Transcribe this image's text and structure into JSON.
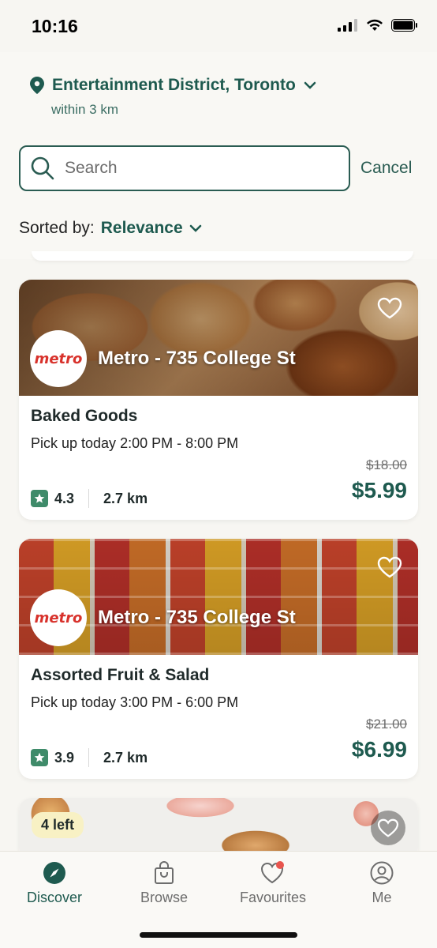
{
  "status_bar": {
    "time": "10:16"
  },
  "location": {
    "name": "Entertainment District, Toronto",
    "radius": "within 3 km"
  },
  "search": {
    "placeholder": "Search",
    "cancel_label": "Cancel"
  },
  "sort": {
    "label": "Sorted by:",
    "value": "Relevance"
  },
  "cards": [
    {
      "store": "Metro - 735 College St",
      "logo_text": "metro",
      "title": "Baked Goods",
      "pickup": "Pick up today 2:00 PM - 8:00 PM",
      "old_price": "$18.00",
      "price": "$5.99",
      "rating": "4.3",
      "distance": "2.7 km"
    },
    {
      "store": "Metro - 735 College St",
      "logo_text": "metro",
      "title": "Assorted Fruit & Salad",
      "pickup": "Pick up today 3:00 PM - 6:00 PM",
      "old_price": "$21.00",
      "price": "$6.99",
      "rating": "3.9",
      "distance": "2.7 km"
    },
    {
      "badge": "4 left"
    }
  ],
  "nav": {
    "discover": "Discover",
    "browse": "Browse",
    "favourites": "Favourites",
    "me": "Me"
  },
  "colors": {
    "brand": "#1e5a4f",
    "accent_star": "#3f8b6a",
    "metro_red": "#d8322c"
  }
}
